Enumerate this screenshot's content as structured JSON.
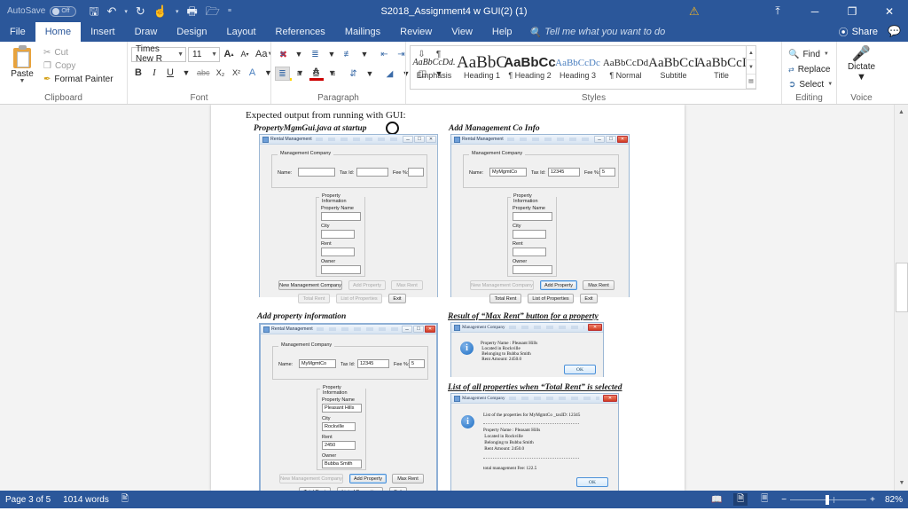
{
  "titlebar": {
    "autosave_label": "AutoSave",
    "autosave_state": "Off",
    "document_title": "S2018_Assignment4 w GUI(2) (1)",
    "quick_access": [
      "save-icon",
      "undo-icon",
      "redo-icon",
      "touch-mode-icon",
      "open-icon",
      "customize-icon"
    ],
    "warning_icon": "⚠",
    "restore_icon": "⤒",
    "minimize_icon": "─",
    "maximize_icon": "❐",
    "close_icon": "✕"
  },
  "tabs": {
    "items": [
      "File",
      "Home",
      "Insert",
      "Draw",
      "Design",
      "Layout",
      "References",
      "Mailings",
      "Review",
      "View",
      "Help"
    ],
    "active": "Home",
    "tell_me": "Tell me what you want to do",
    "share_label": "Share"
  },
  "ribbon": {
    "clipboard": {
      "group_name": "Clipboard",
      "paste_label": "Paste",
      "cut_label": "Cut",
      "copy_label": "Copy",
      "format_painter_label": "Format Painter"
    },
    "font": {
      "group_name": "Font",
      "font_name": "Times New R",
      "font_size": "11",
      "grow_label": "A",
      "shrink_label": "A",
      "change_case_label": "Aa",
      "clear_format_label": "A",
      "bold_label": "B",
      "italic_label": "I",
      "underline_label": "U",
      "strikethrough_label": "abc",
      "subscript_label": "X₂",
      "superscript_label": "X²",
      "text_effects_label": "A",
      "highlight_label": "ab",
      "font_color_label": "A"
    },
    "paragraph": {
      "group_name": "Paragraph"
    },
    "styles": {
      "group_name": "Styles",
      "items": [
        {
          "preview": "AaBbCcDd.",
          "name": "Emphasis"
        },
        {
          "preview": "AaBbC",
          "name": "Heading 1"
        },
        {
          "preview": "AaBbCc",
          "name": "¶ Heading 2"
        },
        {
          "preview": "AaBbCcDc",
          "name": "Heading 3"
        },
        {
          "preview": "AaBbCcDd",
          "name": "¶ Normal"
        },
        {
          "preview": "AaBbCcI",
          "name": "Subtitle"
        },
        {
          "preview": "AaBbCcI",
          "name": "Title"
        }
      ]
    },
    "editing": {
      "group_name": "Editing",
      "find_label": "Find",
      "replace_label": "Replace",
      "select_label": "Select"
    },
    "voice": {
      "group_name": "Voice",
      "dictate_label": "Dictate"
    }
  },
  "document": {
    "intro": "Expected output from running with GUI:",
    "captions": {
      "startup": "PropertyMgmGui.java at startup",
      "add_mgmt": "Add Management Co Info",
      "add_property": "Add property information",
      "max_rent": "Result of “Max Rent” button for a property",
      "total_rent": "List of all properties when “Total Rent” is selected"
    },
    "window_title": "Rental Management",
    "dialog_title": "Management Company",
    "panels": {
      "mgmt_company": "Management Company",
      "property_info": "Property Information"
    },
    "labels": {
      "name": "Name:",
      "tax_id": "Tax Id:",
      "fee_pct": "Fee %:",
      "property_name": "Property Name",
      "city": "City",
      "rent": "Rent",
      "owner": "Owner"
    },
    "buttons": {
      "new_mgmt": "New Management Company",
      "add_property": "Add Property",
      "max_rent": "Max Rent",
      "total_rent": "Total Rent",
      "list_properties": "List of Properties",
      "exit": "Exit",
      "ok": "OK"
    },
    "values": {
      "empty": "",
      "mgmt_name": "MyMgmtCo",
      "tax_id": "12345",
      "fee_pct": "5",
      "property_name": "Pleasant Hills",
      "city": "Rockville",
      "rent": "2450",
      "owner": "Bubba Smith"
    },
    "max_rent_dialog": {
      "line1": "Property Name : Pleasant Hills",
      "line2": " Located in Rockville",
      "line3": " Belonging to Bubba Smith",
      "line4": " Rent Amount: 2450.0"
    },
    "total_rent_dialog": {
      "header": "List of the properties for MyMgmtCo _taxID: 12345",
      "line1": "Property Name : Pleasant Hills",
      "line2": " Located in Rockville",
      "line3": " Belonging to Bubba Smith",
      "line4": " Rent Amount: 2450.0",
      "footer": "total management Fee: 122.5"
    }
  },
  "status": {
    "page": "Page 3 of 5",
    "words": "1014 words",
    "proofing_icon": "spell-check-icon",
    "zoom": "82%",
    "view_read": "read-mode-icon",
    "view_print": "print-layout-icon",
    "view_web": "web-layout-icon",
    "zoom_out": "−",
    "zoom_in": "+"
  }
}
